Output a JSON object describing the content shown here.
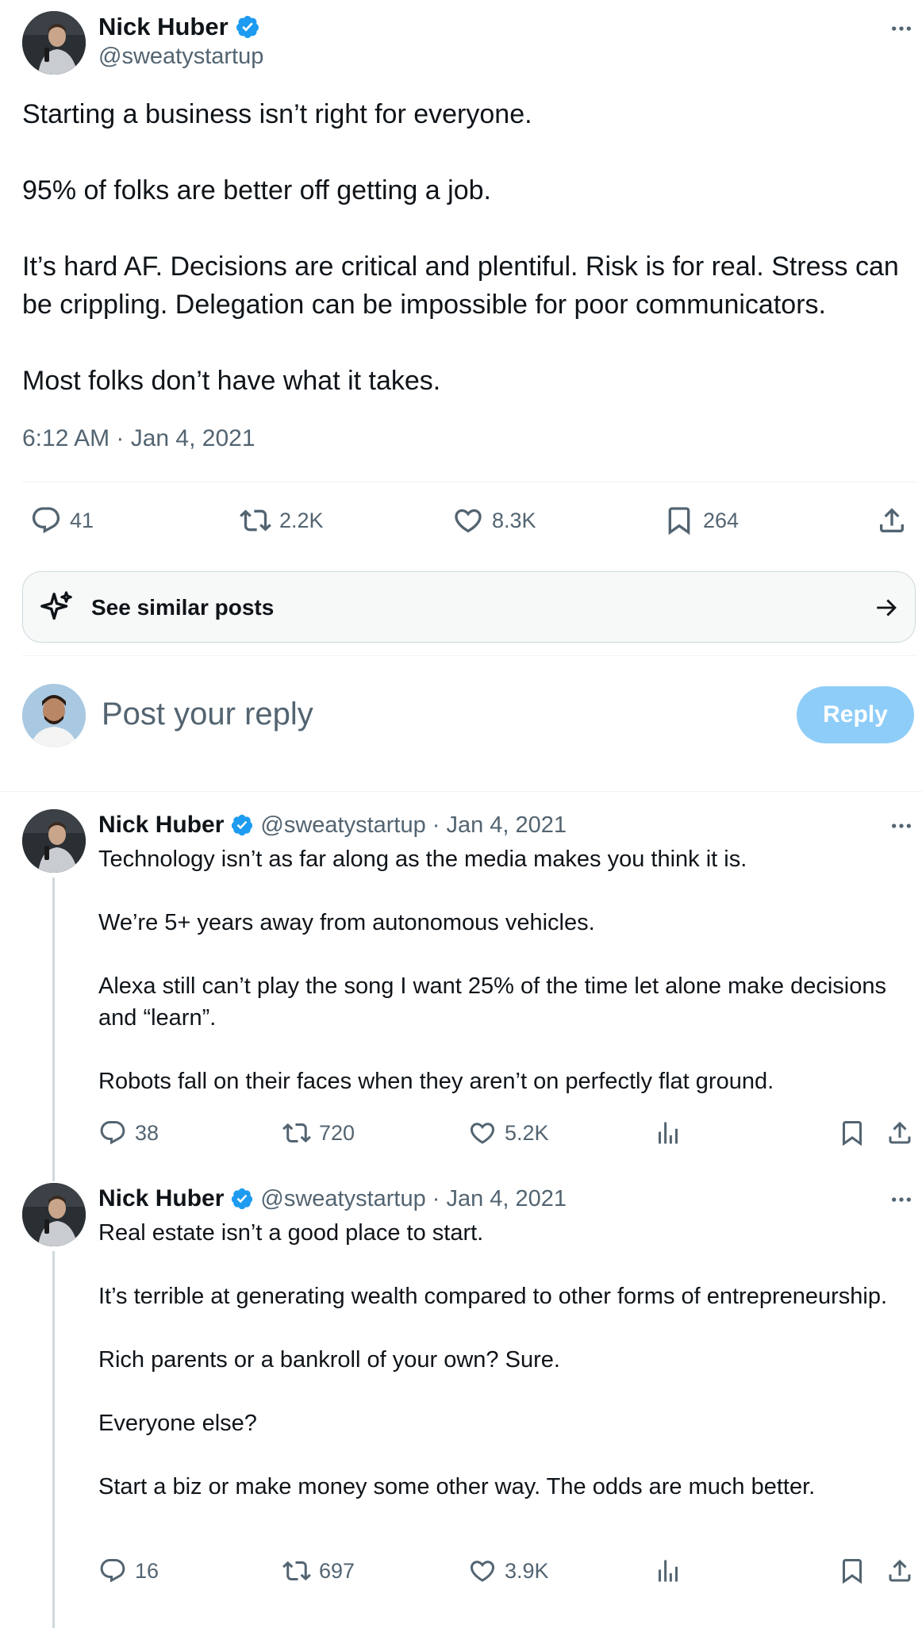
{
  "main_post": {
    "author_name": "Nick Huber",
    "author_handle": "@sweatystartup",
    "paragraphs": [
      "Starting a business isn’t right for everyone.",
      "95% of folks are better off getting a job.",
      "It’s hard AF. Decisions are critical and plentiful. Risk is for real. Stress can be crippling. Delegation can be impossible for poor communicators.",
      "Most folks don’t have what it takes."
    ],
    "timestamp": "6:12 AM · Jan 4, 2021",
    "stats": {
      "replies": "41",
      "reposts": "2.2K",
      "likes": "8.3K",
      "bookmarks": "264"
    }
  },
  "similar_posts": {
    "label": "See similar posts"
  },
  "reply_composer": {
    "placeholder": "Post your reply",
    "button_label": "Reply"
  },
  "replies": [
    {
      "author_name": "Nick Huber",
      "author_handle": "@sweatystartup",
      "date": "· Jan 4, 2021",
      "paragraphs": [
        "Technology isn’t as far along as the media makes you think it is.",
        "We’re 5+ years away from autonomous vehicles.",
        "Alexa still can’t play the song I want 25% of the time let alone make decisions and “learn”.",
        "Robots fall on their faces when they aren’t on perfectly flat ground."
      ],
      "stats": {
        "replies": "38",
        "reposts": "720",
        "likes": "5.2K"
      }
    },
    {
      "author_name": "Nick Huber",
      "author_handle": "@sweatystartup",
      "date": "· Jan 4, 2021",
      "paragraphs": [
        "Real estate isn’t a good place to start.",
        "It’s terrible at generating wealth compared to other forms of entrepreneurship.",
        "Rich parents or a bankroll of your own? Sure.",
        "Everyone else?",
        "Start a biz or make money some other way. The odds are much better."
      ],
      "stats": {
        "replies": "16",
        "reposts": "697",
        "likes": "3.9K"
      }
    }
  ],
  "icons": {
    "verified": "verified-badge-icon",
    "more": "more-options-icon",
    "reply": "reply-bubble-icon",
    "repost": "repost-icon",
    "like": "heart-icon",
    "bookmark": "bookmark-icon",
    "share": "share-icon",
    "views": "analytics-icon",
    "sparkle": "sparkle-icon",
    "arrow": "arrow-right-icon"
  },
  "colors": {
    "text_primary": "#0f1419",
    "text_secondary": "#536471",
    "verified_blue": "#1d9bf0",
    "reply_button_disabled": "#8ecdf8",
    "border": "#cfd9de"
  }
}
